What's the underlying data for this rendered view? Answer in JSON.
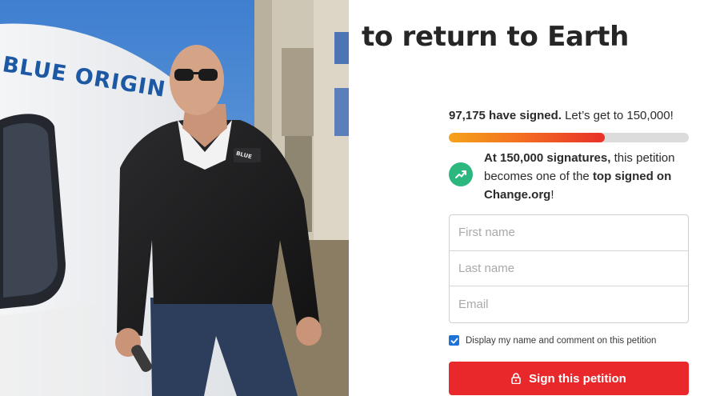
{
  "petition": {
    "title": "to return to Earth",
    "signed_count": "97,175 have signed.",
    "goal_text": "Let’s get to 150,000!",
    "progress_fraction": 0.65,
    "milestone": {
      "bold_lead": "At 150,000 signatures,",
      "middle": "this petition becomes one of the",
      "bold_tail": "top signed on Change.org",
      "end": "!",
      "icon": "trending-up-icon"
    },
    "form": {
      "first_name_placeholder": "First name",
      "last_name_placeholder": "Last name",
      "email_placeholder": "Email",
      "first_name_value": "",
      "last_name_value": "",
      "email_value": ""
    },
    "consent_label": "Display my name and comment on this petition",
    "consent_checked": true,
    "sign_button_label": "Sign this petition",
    "sign_button_icon": "lock-icon"
  },
  "photo": {
    "capsule_lettering": "BLUE ORIGIN",
    "jacket_logo": "BLUE ORIGIN"
  },
  "colors": {
    "sign_button": "#e9282c",
    "progress_start": "#f6a21b",
    "progress_end": "#e8302a",
    "milestone_badge": "#2cb77f",
    "checkbox": "#1b72d9"
  }
}
